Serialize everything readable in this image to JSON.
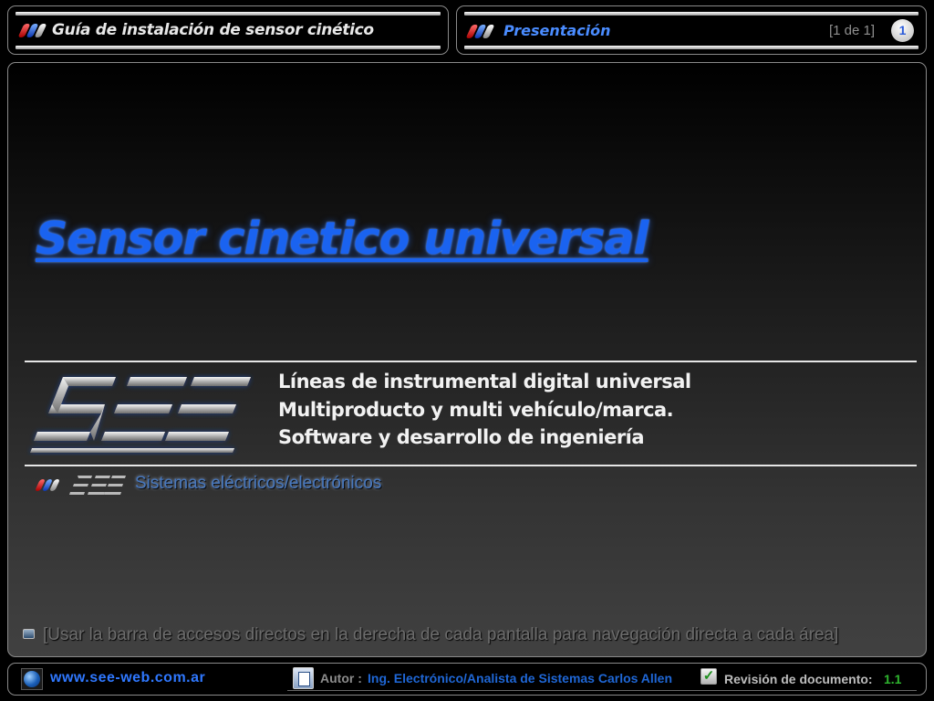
{
  "header": {
    "guide_title": "Guía de instalación de sensor cinético",
    "section_title": "Presentación",
    "page_count": "[1 de 1]",
    "page_number": "1"
  },
  "main": {
    "title": "Sensor cinetico universal",
    "taglines": [
      "Líneas de instrumental digital universal",
      "Multiproducto y multi vehículo/marca.",
      "Software y desarrollo de ingeniería"
    ],
    "company_name": "Sistemas eléctricos/electrónicos",
    "nav_hint": "[Usar la barra de accesos directos en la derecha de cada pantalla para navegación directa a cada área]"
  },
  "footer": {
    "website": "www.see-web.com.ar",
    "author_label": "Autor :",
    "author_name": "Ing. Electrónico/Analista de Sistemas Carlos Allen",
    "revision_label": "Revisión de documento:",
    "revision_value": "1.1"
  },
  "icons": {
    "brand_stripes": "tricolor-stripes-icon",
    "logo": "see-logo",
    "globe": "globe-icon",
    "document": "document-icon",
    "check": "checkmark-icon",
    "bullet": "square-bullet-icon"
  },
  "colors": {
    "accent_blue": "#1a63f0",
    "link_blue": "#2f78ff",
    "revision_green": "#2fb52f",
    "stripe_red": "#c81818",
    "stripe_blue": "#1a4fd0"
  }
}
